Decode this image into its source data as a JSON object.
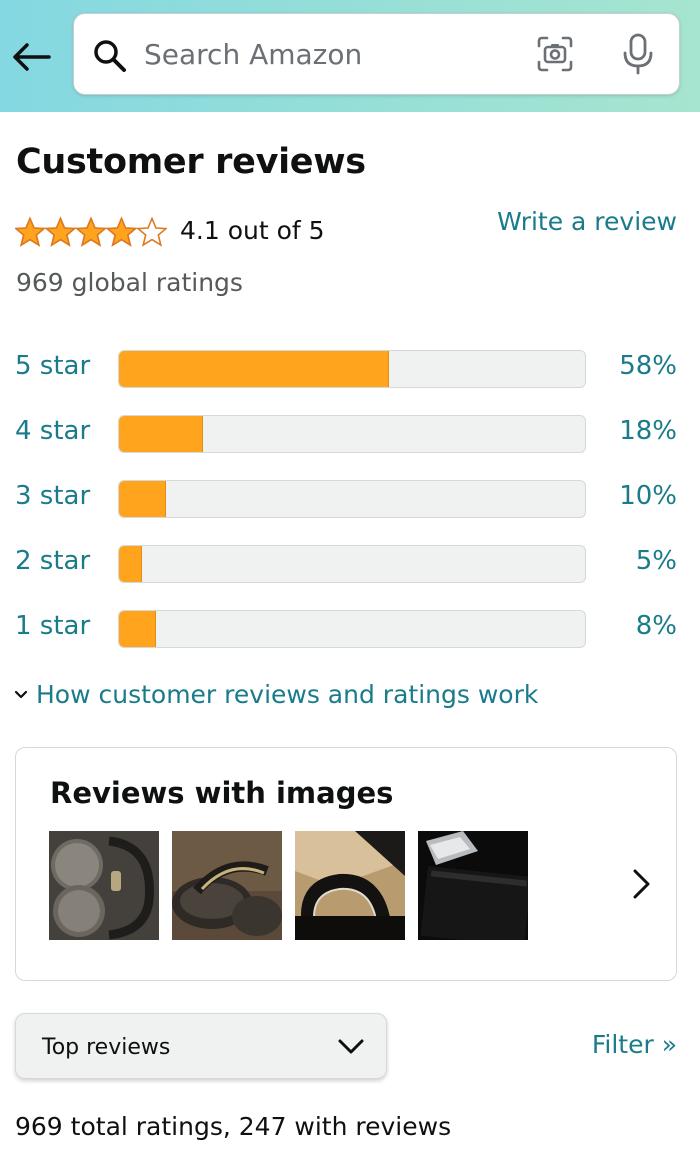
{
  "header": {
    "search_placeholder": "Search Amazon",
    "background_colors": [
      "#84d8e1",
      "#a6e5cf"
    ],
    "icons": [
      "back-arrow-icon",
      "search-icon",
      "camera-scan-icon",
      "microphone-icon"
    ]
  },
  "reviews": {
    "title": "Customer reviews",
    "average_rating": 4.1,
    "rating_text": "4.1 out of 5",
    "write_review": "Write a review",
    "global_ratings": "969 global ratings",
    "histogram": [
      {
        "label": "5 star",
        "percent": 58,
        "percent_text": "58%"
      },
      {
        "label": "4 star",
        "percent": 18,
        "percent_text": "18%"
      },
      {
        "label": "3 star",
        "percent": 10,
        "percent_text": "10%"
      },
      {
        "label": "2 star",
        "percent": 5,
        "percent_text": "5%"
      },
      {
        "label": "1 star",
        "percent": 8,
        "percent_text": "8%"
      }
    ],
    "how_it_works": "How customer reviews and ratings work",
    "accent_color": "#1a7b8a",
    "star_color": "#ffa41c"
  },
  "images_section": {
    "title": "Reviews with images",
    "thumbnails": [
      "headphones-folded-photo",
      "headphones-on-desk-photo",
      "headphones-headband-photo",
      "headphones-box-photo"
    ],
    "more_icon": "chevron-right-icon"
  },
  "sort": {
    "selected": "Top reviews",
    "filter": "Filter »",
    "total": "969 total ratings, 247 with reviews"
  }
}
